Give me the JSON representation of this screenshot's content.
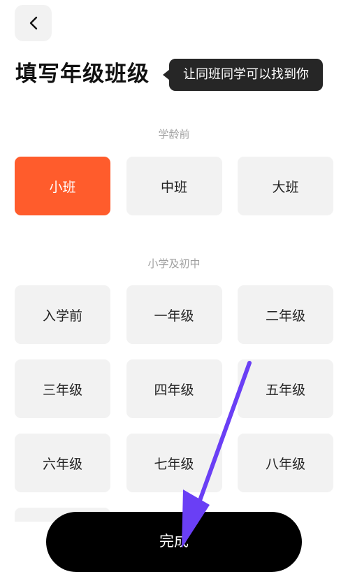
{
  "header": {
    "back_icon": "chevron-left-icon",
    "title": "填写年级班级",
    "tooltip": "让同班同学可以找到你"
  },
  "sections": [
    {
      "label": "学龄前",
      "options": [
        {
          "label": "小班",
          "selected": true
        },
        {
          "label": "中班",
          "selected": false
        },
        {
          "label": "大班",
          "selected": false
        }
      ]
    },
    {
      "label": "小学及初中",
      "options": [
        {
          "label": "入学前"
        },
        {
          "label": "一年级"
        },
        {
          "label": "二年级"
        },
        {
          "label": "三年级"
        },
        {
          "label": "四年级"
        },
        {
          "label": "五年级"
        },
        {
          "label": "六年级"
        },
        {
          "label": "七年级"
        },
        {
          "label": "八年级"
        }
      ]
    }
  ],
  "footer": {
    "done_label": "完成"
  },
  "colors": {
    "accent": "#ff5c2c",
    "chip_bg": "#f2f2f2",
    "annotation_arrow": "#6a3ff5"
  }
}
